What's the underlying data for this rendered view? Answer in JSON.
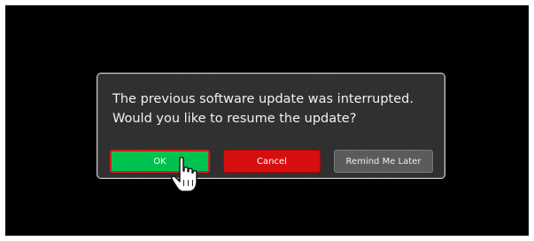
{
  "dialog": {
    "message_line1": "The previous software update was interrupted.",
    "message_line2": "Would you like to resume the update?",
    "ok_label": "OK",
    "cancel_label": "Cancel",
    "later_label": "Remind Me Later"
  },
  "cursor": {
    "icon": "hand-pointer-icon"
  },
  "colors": {
    "background": "#000000",
    "ok": "#00c34f",
    "ok_border": "#d81c1c",
    "cancel": "#d60e0e",
    "later": "#5b5b5b"
  }
}
